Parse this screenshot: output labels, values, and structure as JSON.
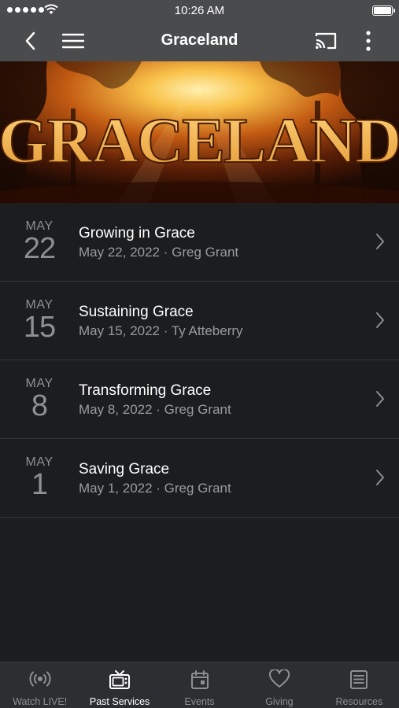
{
  "status_bar": {
    "time": "10:26 AM"
  },
  "nav": {
    "title": "Graceland"
  },
  "banner": {
    "text": "GRACELAND"
  },
  "sermons": [
    {
      "month": "MAY",
      "day": "22",
      "title": "Growing in Grace",
      "subtitle": "May 22, 2022 · Greg Grant"
    },
    {
      "month": "MAY",
      "day": "15",
      "title": "Sustaining Grace",
      "subtitle": "May 15, 2022 · Ty Atteberry"
    },
    {
      "month": "MAY",
      "day": "8",
      "title": "Transforming Grace",
      "subtitle": "May 8, 2022 · Greg Grant"
    },
    {
      "month": "MAY",
      "day": "1",
      "title": "Saving Grace",
      "subtitle": "May 1, 2022 · Greg Grant"
    }
  ],
  "tabs": [
    {
      "label": "Watch LIVE!",
      "icon": "broadcast-icon",
      "active": false
    },
    {
      "label": "Past Services",
      "icon": "tv-icon",
      "active": true
    },
    {
      "label": "Events",
      "icon": "calendar-icon",
      "active": false
    },
    {
      "label": "Giving",
      "icon": "heart-icon",
      "active": false
    },
    {
      "label": "Resources",
      "icon": "document-icon",
      "active": false
    }
  ],
  "colors": {
    "nav_bg": "#4a4b4d",
    "list_bg": "#1c1d1f",
    "tab_bg": "#2d2e31",
    "banner_text": "#f0b04a"
  }
}
